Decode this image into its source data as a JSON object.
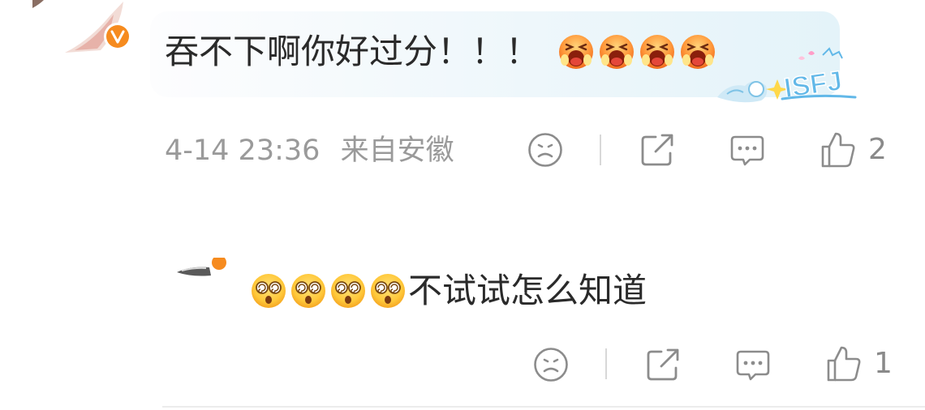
{
  "comment1": {
    "text": "吞不下啊你好过分！！！",
    "emoji_name": "scream-crying-emoji",
    "emoji_count": 4,
    "badge_text": "ISFJ",
    "timestamp": "4-14 23:36",
    "location": "来自安徽",
    "like_count": "2"
  },
  "comment2": {
    "text": "不试试怎么知道",
    "emoji_name": "dizzy-eyes-emoji",
    "emoji_count": 4,
    "like_count": "1"
  },
  "icons": {
    "frown": "frown-icon",
    "share": "share-icon",
    "comment": "comment-icon",
    "like": "thumbs-up-icon",
    "verified": "verified-v-icon"
  },
  "colors": {
    "verified_badge": "#f68b1f",
    "meta_text": "#9a9a9a",
    "icon_stroke": "#8c8c8c",
    "badge_blue": "#62b8e8"
  }
}
